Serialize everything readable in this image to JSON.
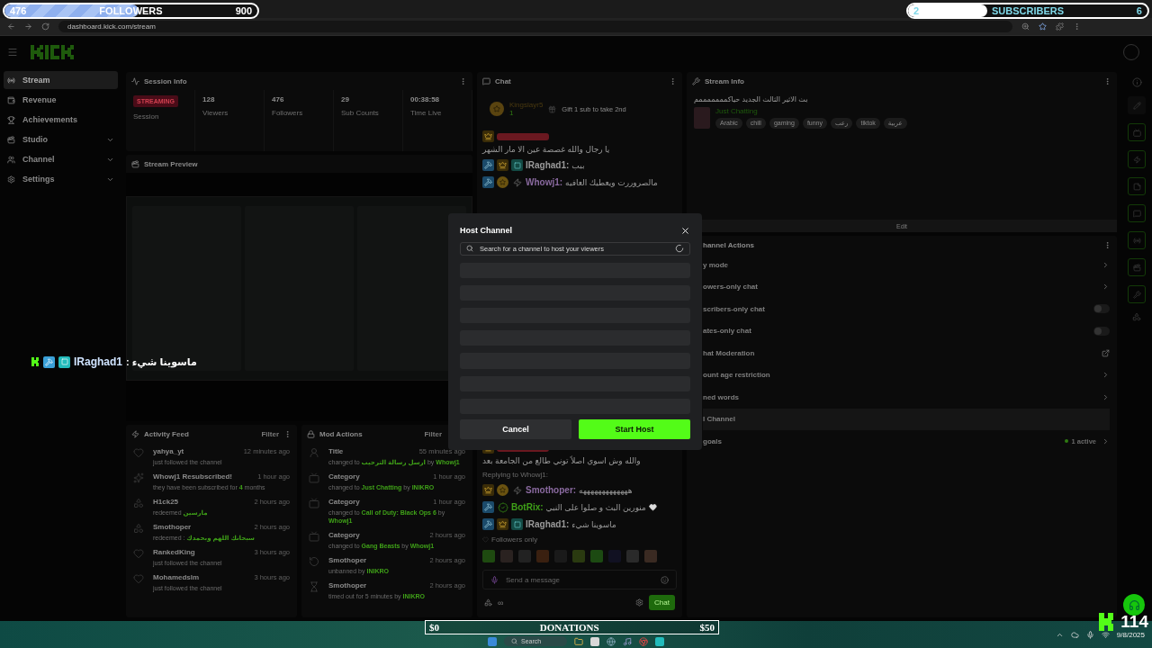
{
  "browser": {
    "url": "dashboard.kick.com/stream"
  },
  "followers_goal": {
    "current": "476",
    "label": "FOLLOWERS",
    "target": "900",
    "level": 0.53
  },
  "subscribers_goal": {
    "current": "2",
    "label": "SUBSCRIBERS",
    "target": "6",
    "level": 0.33
  },
  "sidebar": {
    "items": [
      {
        "label": "Stream",
        "kind": "stream",
        "selected": true,
        "expandable": false
      },
      {
        "label": "Revenue",
        "kind": "revenue",
        "selected": false,
        "expandable": false
      },
      {
        "label": "Achievements",
        "kind": "trophy",
        "selected": false,
        "expandable": false
      },
      {
        "label": "Studio",
        "kind": "studio",
        "selected": false,
        "expandable": true
      },
      {
        "label": "Channel",
        "kind": "channel",
        "selected": false,
        "expandable": true
      },
      {
        "label": "Settings",
        "kind": "settings",
        "selected": false,
        "expandable": true
      }
    ]
  },
  "session_info": {
    "title": "Session Info",
    "status": "STREAMING",
    "status_label": "Session",
    "stats": [
      {
        "value": "128",
        "label": "Viewers"
      },
      {
        "value": "476",
        "label": "Followers"
      },
      {
        "value": "29",
        "label": "Sub Counts"
      },
      {
        "value": "00:38:58",
        "label": "Time Live"
      }
    ]
  },
  "stream_preview": {
    "title": "Stream Preview"
  },
  "overlay_message": {
    "user": "IRaghad1",
    "text": ": ماسوينا شيء"
  },
  "activity_feed": {
    "title": "Activity Feed",
    "filter": "Filter",
    "items": [
      {
        "kind": "follow",
        "user": "yahya_yt",
        "time": "12 minutes ago",
        "detail": [
          {
            "text": "just followed the channel",
            "accent": false
          }
        ]
      },
      {
        "kind": "resub",
        "user": "Whowj1 Resubscribed!",
        "time": "1 hour ago",
        "detail": [
          {
            "text": "they have been subscribed for ",
            "accent": false
          },
          {
            "text": "4",
            "accent": true
          },
          {
            "text": " months",
            "accent": false
          }
        ]
      },
      {
        "kind": "redeem",
        "user": "H1ck25",
        "time": "2 hours ago",
        "detail": [
          {
            "text": "redeemed ",
            "accent": false
          },
          {
            "text": "مارسين",
            "accent": true
          }
        ]
      },
      {
        "kind": "redeem",
        "user": "Smothoper",
        "time": "2 hours ago",
        "detail": [
          {
            "text": "redeemed : ",
            "accent": false
          },
          {
            "text": "سبحانك اللهم وبحمدك",
            "accent": true
          }
        ]
      },
      {
        "kind": "follow",
        "user": "RankedKing",
        "time": "3 hours ago",
        "detail": [
          {
            "text": "just followed the channel",
            "accent": false
          }
        ]
      },
      {
        "kind": "follow",
        "user": "Mohamedslm",
        "time": "3 hours ago",
        "detail": [
          {
            "text": "just followed the channel",
            "accent": false
          }
        ]
      }
    ]
  },
  "mod_actions": {
    "title": "Mod Actions",
    "filter": "Filter",
    "items": [
      {
        "kind": "title",
        "label": "Title",
        "time": "55 minutes ago",
        "detail": [
          {
            "text": "changed to ",
            "accent": false
          },
          {
            "text": "ارسل رسالة الترحيب",
            "accent": true
          },
          {
            "text": " by ",
            "accent": false
          },
          {
            "text": "Whowj1",
            "accent": true
          }
        ]
      },
      {
        "kind": "category",
        "label": "Category",
        "time": "1 hour ago",
        "detail": [
          {
            "text": "changed to ",
            "accent": false
          },
          {
            "text": "Just Chatting",
            "accent": true
          },
          {
            "text": " by ",
            "accent": false
          },
          {
            "text": "INIKRO",
            "accent": true
          }
        ]
      },
      {
        "kind": "category",
        "label": "Category",
        "time": "1 hour ago",
        "detail": [
          {
            "text": "changed to ",
            "accent": false
          },
          {
            "text": "Call of Duty: Black Ops 6",
            "accent": true
          },
          {
            "text": " by ",
            "accent": false
          },
          {
            "text": "Whowj1",
            "accent": true
          }
        ]
      },
      {
        "kind": "category",
        "label": "Category",
        "time": "2 hours ago",
        "detail": [
          {
            "text": "changed to ",
            "accent": false
          },
          {
            "text": "Gang Beasts",
            "accent": true
          },
          {
            "text": " by ",
            "accent": false
          },
          {
            "text": "Whowj1",
            "accent": true
          }
        ]
      },
      {
        "kind": "unban",
        "label": "Smothoper",
        "time": "2 hours ago",
        "detail": [
          {
            "text": "unbanned by ",
            "accent": false
          },
          {
            "text": "INIKRO",
            "accent": true
          }
        ]
      },
      {
        "kind": "timeout",
        "label": "Smothoper",
        "time": "2 hours ago",
        "detail": [
          {
            "text": "timed out for 5 minutes by ",
            "accent": false
          },
          {
            "text": "INIKRO",
            "accent": true
          }
        ]
      }
    ]
  },
  "chat": {
    "title": "Chat",
    "pinned": {
      "user": "Kingslayr5",
      "count": "1",
      "text": "Gift 1 sub to take 2nd"
    },
    "messages_above": [
      {
        "badges": [
          {
            "kind": "vip"
          }
        ],
        "text": "يا رجال والله غصصة عين الا مار الشهر"
      },
      {
        "badges": [
          {
            "kind": "mod"
          },
          {
            "kind": "vip"
          },
          {
            "kind": "sub"
          }
        ],
        "user": "IRaghad1:",
        "color": "#9a9a9a",
        "text": "ببب"
      },
      {
        "badges": [
          {
            "kind": "mod"
          },
          {
            "kind": "coin"
          },
          {
            "kind": "og"
          }
        ],
        "user": "Whowj1:",
        "color": "#8a6aa0",
        "text": "مالصروررت ويعطيك العافيه"
      }
    ],
    "messages_below": [
      {
        "badges": [
          {
            "kind": "vip"
          }
        ],
        "text": "والله وش اسوي اصلاً توني طالع من الجامعة بعد"
      },
      {
        "reply": "Replying to Whowj1:"
      },
      {
        "badges": [
          {
            "kind": "vip"
          },
          {
            "kind": "coin"
          },
          {
            "kind": "og"
          }
        ],
        "user": "Smothoper:",
        "color": "#8a6aa0",
        "text": "هههههههههههههه"
      },
      {
        "badges": [
          {
            "kind": "mod"
          },
          {
            "kind": "verified"
          }
        ],
        "user": "BotRix:",
        "color": "#3fa018",
        "text": "منورين البث و صلوا على النبي",
        "heart": true
      },
      {
        "badges": [
          {
            "kind": "mod"
          },
          {
            "kind": "vip"
          },
          {
            "kind": "sub"
          }
        ],
        "user": "IRaghad1:",
        "color": "#9a9a9a",
        "text": "ماسوينا شيء"
      }
    ],
    "mode": "Followers only",
    "placeholder": "Send a message",
    "pace": "∞",
    "send": "Chat"
  },
  "stream_info": {
    "title": "Stream Info",
    "stream_title": "بث الاثير الثالث الجديد حياكمممممممم",
    "category": "Just Chatting",
    "tags": [
      "Arabic",
      "chill",
      "gaming",
      "funny",
      "رعب",
      "tiktok",
      "عربية"
    ],
    "edit": "Edit"
  },
  "channel_actions": {
    "title": "hannel Actions",
    "items": [
      {
        "label": "y mode",
        "kind": "link"
      },
      {
        "label": "owers-only chat",
        "kind": "link"
      },
      {
        "label": "scribers-only chat",
        "kind": "toggle",
        "on": false
      },
      {
        "label": "ates-only chat",
        "kind": "toggle",
        "on": false
      },
      {
        "label": "hat Moderation",
        "kind": "external"
      },
      {
        "label": "ount age restriction",
        "kind": "link"
      },
      {
        "label": "ned words",
        "kind": "link"
      },
      {
        "label": "l Channel",
        "kind": "section"
      },
      {
        "label": "goals",
        "kind": "status",
        "status": "1 active"
      }
    ]
  },
  "modal": {
    "title": "Host Channel",
    "placeholder": "Search for a channel to host your viewers",
    "loading": true,
    "cancel": "Cancel",
    "confirm": "Start Host"
  },
  "donations_goal": {
    "current": "$0",
    "label": "DONATIONS",
    "target": "$50",
    "level": 0
  },
  "viewer_counter": {
    "value": "114"
  },
  "taskbar": {
    "search": "Search",
    "date": "9/8/2025"
  }
}
